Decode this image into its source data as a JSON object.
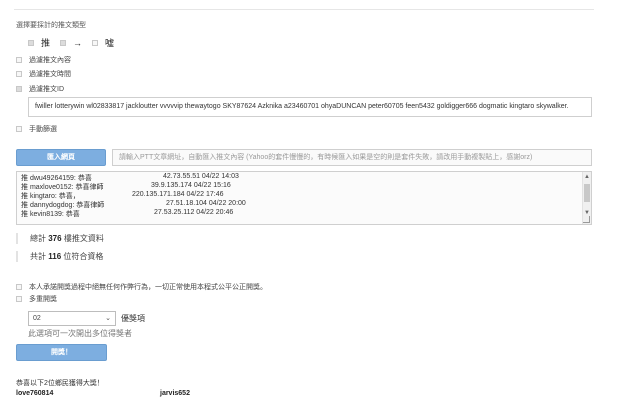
{
  "section_title": "選擇要採計的推文類型",
  "push_types": [
    {
      "label": "推",
      "checked": true
    },
    {
      "label": "→",
      "checked": true
    },
    {
      "label": "噓",
      "checked": false
    }
  ],
  "options": {
    "filter_content": "過濾推文內容",
    "filter_time": "過濾推文時間",
    "filter_id": "過濾推文ID",
    "manual_filter": "手動篩選"
  },
  "id_filter_value": "fwiller lotterywin wl02833817 jackloutter vvvvvip thewaytogo SKY87624 Azknika a23460701 ohyaDUNCAN peter60705 feen5432 goldigger666 dogmatic kingtaro skywalker.",
  "import_button": "匯入網頁",
  "url_placeholder": "請輸入PTT文章網址，自動匯入推文內容 (Yahoo的套件慢慢的，有時候匯入如果是空的則是套件失敗，請改用手動複製貼上，感謝orz)",
  "comments": [
    {
      "text": "推 dwu49264159: 恭喜",
      "meta": "42.73.55.51 04/22 14:03"
    },
    {
      "text": "推 maxlove0152: 恭喜律師",
      "meta": "39.9.135.174 04/22 15:16"
    },
    {
      "text": "推 kingtaro: 恭喜，",
      "meta": "220.135.171.184 04/22 17:46"
    },
    {
      "text": "推 dannydogdog: 恭喜律師",
      "meta": "27.51.18.104 04/22 20:00"
    },
    {
      "text": "推 kevin8139: 恭喜",
      "meta": "27.53.25.112 04/22 20:46"
    }
  ],
  "stats": {
    "total_prefix": "總計",
    "total_count": "376",
    "total_suffix": "樓推文資料",
    "qualified_prefix": "共計",
    "qualified_count": "116",
    "qualified_suffix": "位符合資格"
  },
  "fair_checkbox_label": "本人承諾開獎過程中絕無任何作弊行為，一切正常使用本程式公平公正開獎。",
  "multi_prize_label": "多重開獎",
  "winner_count_select": "02",
  "prize_label": "優獎項",
  "select_hint": "此選項可一次開出多位得獎者",
  "draw_button": "開獎！",
  "winners_title": "恭喜以下2位鄉民獲得大獎！",
  "winners": [
    "love760814",
    "jarvis652"
  ]
}
